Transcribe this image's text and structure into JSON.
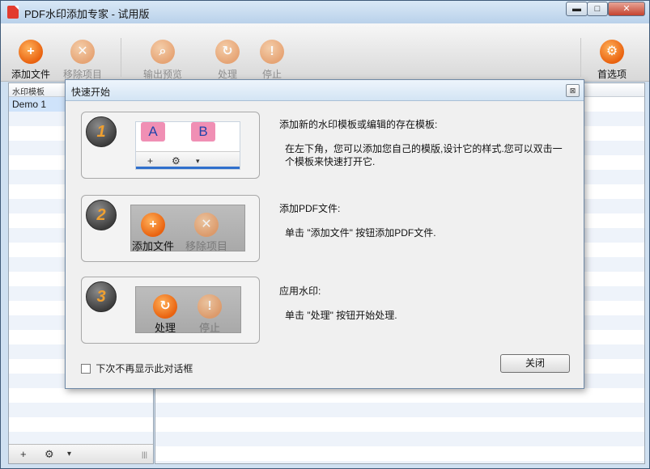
{
  "window": {
    "title": "PDF水印添加专家 - 试用版",
    "min": "▬",
    "max": "□",
    "close": "✕"
  },
  "toolbar": {
    "add_file": {
      "label": "添加文件",
      "icon": "add-file-icon"
    },
    "remove_item": {
      "label": "移除项目",
      "icon": "remove-icon"
    },
    "output_preview": {
      "label": "输出预览",
      "icon": "preview-icon"
    },
    "process": {
      "label": "处理",
      "icon": "process-icon"
    },
    "stop": {
      "label": "停止",
      "icon": "stop-icon"
    },
    "preferences": {
      "label": "首选项",
      "icon": "preferences-icon"
    }
  },
  "template_panel": {
    "header": "水印模板",
    "items": [
      "Demo 1"
    ],
    "footer": {
      "add": "+",
      "settings": "⚙",
      "dropdown": "▾",
      "grip": "|||"
    }
  },
  "dialog": {
    "title": "快速开始",
    "close_x": "⊠",
    "steps": [
      {
        "number": "1",
        "illustration": {
          "tag_a": "A",
          "tag_b": "B",
          "add": "+",
          "settings": "⚙",
          "dropdown": "▾"
        },
        "heading": "添加新的水印模板或编辑的存在模板:",
        "body": "在左下角，您可以添加您自己的模版,设计它的样式.您可以双击一个模板来快速打开它."
      },
      {
        "number": "2",
        "illustration": {
          "add_label": "添加文件",
          "remove_label": "移除项目"
        },
        "heading": "添加PDF文件:",
        "body": "单击 \"添加文件\" 按钮添加PDF文件."
      },
      {
        "number": "3",
        "illustration": {
          "process_label": "处理",
          "stop_label": "停止"
        },
        "heading": "应用水印:",
        "body": "单击 \"处理\" 按钮开始处理."
      }
    ],
    "dont_show_again": "下次不再显示此对话框",
    "close_button": "关闭"
  },
  "colors": {
    "accent": "#e9620f",
    "titlebar": "#c9dcf0",
    "selection": "#cfe3fa"
  }
}
